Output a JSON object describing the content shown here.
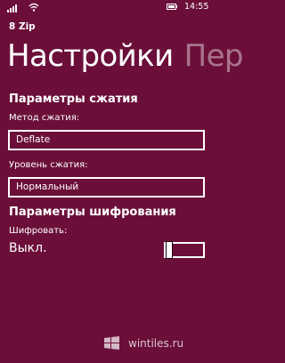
{
  "status_bar": {
    "time": "14:55",
    "icons": [
      "signal-icon",
      "wifi-icon",
      "battery-icon"
    ]
  },
  "app": {
    "title": "8 Zip"
  },
  "pivot": {
    "active": "Настройки",
    "next": "Пер"
  },
  "compression": {
    "section_title": "Параметры сжатия",
    "method_label": "Метод сжатия:",
    "method_value": "Deflate",
    "level_label": "Уровень сжатия:",
    "level_value": "Нормальный"
  },
  "encryption": {
    "section_title": "Параметры шифрования",
    "encrypt_label": "Шифровать:",
    "encrypt_state": "Выкл.",
    "encrypt_on": false
  },
  "watermark": {
    "text": "wintiles.ru"
  },
  "colors": {
    "background": "#6b0f3a",
    "foreground": "#ffffff"
  }
}
